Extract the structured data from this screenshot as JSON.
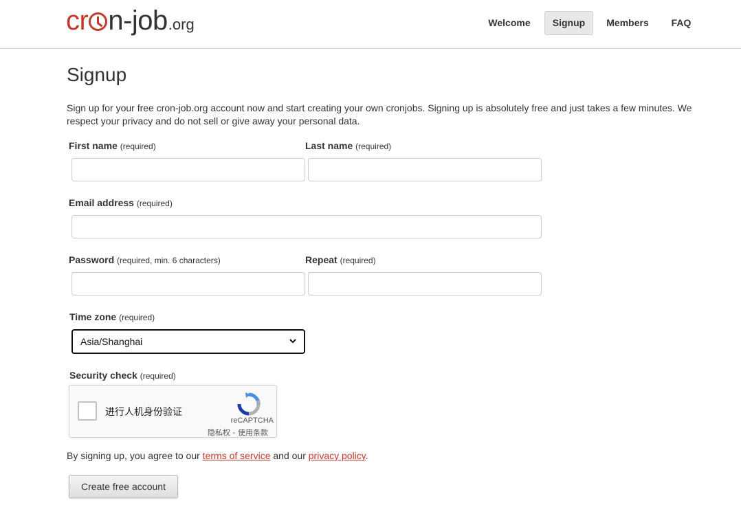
{
  "logo": {
    "part1": "cr",
    "part2": "n-job",
    "part3": ".org"
  },
  "nav": [
    {
      "label": "Welcome"
    },
    {
      "label": "Signup"
    },
    {
      "label": "Members"
    },
    {
      "label": "FAQ"
    }
  ],
  "page": {
    "title": "Signup",
    "intro": "Sign up for your free cron-job.org account now and start creating your own cronjobs. Signing up is absolutely free and just takes a few minutes. We respect your privacy and do not sell or give away your personal data."
  },
  "form": {
    "first_name": {
      "label": "First name",
      "note": "(required)",
      "value": ""
    },
    "last_name": {
      "label": "Last name",
      "note": "(required)",
      "value": ""
    },
    "email": {
      "label": "Email address",
      "note": "(required)",
      "value": ""
    },
    "password": {
      "label": "Password",
      "note": "(required, min. 6 characters)",
      "value": ""
    },
    "repeat": {
      "label": "Repeat",
      "note": "(required)",
      "value": ""
    },
    "timezone": {
      "label": "Time zone",
      "note": "(required)",
      "value": "Asia/Shanghai"
    },
    "security": {
      "label": "Security check",
      "note": "(required)"
    }
  },
  "captcha": {
    "checkbox_text": "进行人机身份验证",
    "brand": "reCAPTCHA",
    "links": "隐私权 - 使用条款"
  },
  "agree": {
    "prefix": "By signing up, you agree to our ",
    "terms_link": "terms of service",
    "middle": " and our ",
    "privacy_link": "privacy policy",
    "suffix": "."
  },
  "submit_label": "Create free account",
  "colors": {
    "brand_red": "#c0392b",
    "text": "#333333",
    "nav_active_bg": "#e8e8e8"
  }
}
